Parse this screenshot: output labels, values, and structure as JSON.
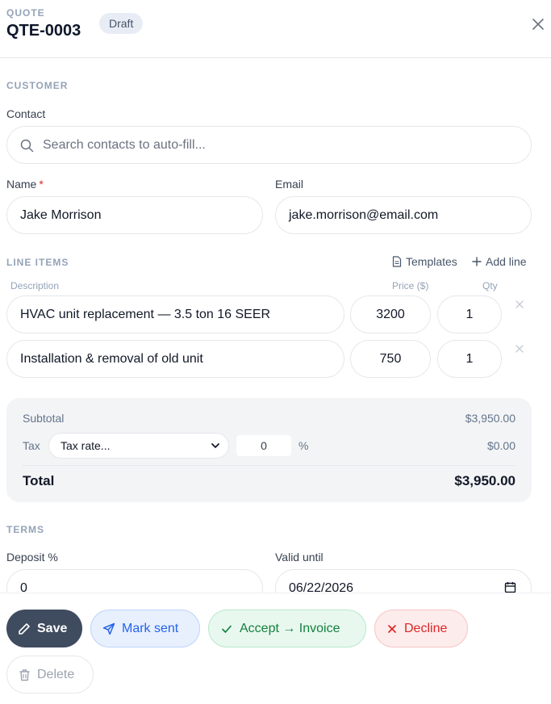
{
  "header": {
    "kicker": "QUOTE",
    "quote_id": "QTE-0003",
    "status_badge": "Draft",
    "close_icon": "close-icon"
  },
  "customer": {
    "section_label": "CUSTOMER",
    "contact_label": "Contact",
    "contact_placeholder": "Search contacts to auto-fill...",
    "name_label": "Name",
    "name_required_mark": "*",
    "name_value": "Jake Morrison",
    "email_label": "Email",
    "email_value": "jake.morrison@email.com"
  },
  "line_items": {
    "section_label": "LINE ITEMS",
    "templates_label": "Templates",
    "add_line_label": "Add line",
    "col_description": "Description",
    "col_price": "Price ($)",
    "col_qty": "Qty",
    "rows": [
      {
        "description": "HVAC unit replacement — 3.5 ton 16 SEER",
        "price": "3200",
        "qty": "1"
      },
      {
        "description": "Installation & removal of old unit",
        "price": "750",
        "qty": "1"
      }
    ]
  },
  "totals": {
    "subtotal_label": "Subtotal",
    "subtotal_value": "$3,950.00",
    "tax_label": "Tax",
    "tax_select_value": "Tax rate...",
    "tax_rate_value": "0",
    "tax_percent_sign": "%",
    "tax_value": "$0.00",
    "total_label": "Total",
    "total_value": "$3,950.00"
  },
  "terms": {
    "section_label": "TERMS",
    "deposit_label": "Deposit %",
    "deposit_value": "0",
    "valid_until_label": "Valid until",
    "valid_until_value": "06/22/2026"
  },
  "actions": {
    "save": "Save",
    "mark_sent": "Mark sent",
    "accept": "Accept → Invoice",
    "decline": "Decline",
    "delete": "Delete"
  },
  "colors": {
    "accent_blue": "#2563eb",
    "accept_green": "#15803d",
    "decline_red": "#dc2626",
    "save_dark": "#3f4b5e"
  }
}
